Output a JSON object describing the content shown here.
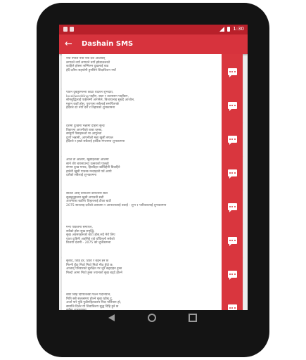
{
  "status_bar": {
    "time": "1:30"
  },
  "app_bar": {
    "back_icon": "←",
    "title": "Dashain SMS"
  },
  "sms_list": [
    {
      "text": "नयाँ नेपाल नयाँ नयाँ दशैं आउन्छर्\nलगाउने नयाँ लगाउने नयाँ झोडाजलको\nकाहिले होस्सा सम्मिलन दुखलाई बाड\nहेर्दै दशैंमा सहयोगी हुनसिने शिदाविजन नयाँ"
    },
    {
      "text": "पावन दुबकुमिल्ला काढा थेर्दैतल शुभदेवा,\nlocal/wedding पाहीए, बाटा र उल्लासन पाहाँछन,\nसोमबुद्धिलाई पाईसम्मी आगमेले, बिजायलाइ सुख्दै आजोल,\nमहान् कहाँ होस्, पुराणमा सबैलाई समर्पितगर्छ\nहेर्दैतल दर नयाँ दशै र तिहारको शुभकामना"
    },
    {
      "text": "दशैंमा दुःखमा भन्नामी दहिनी सुन्दः\nतिहारमा आफ्नीको बाबा रहन्छ,\nसम्मुगाँ पैसाहरूलो मा आपुरुवा\nदुःगाँ भन्नामी, आफ्नीलो मन्ना खुसी सफल\nहेर्दैतले र हाम्रो सबैलाई हार्दिक मंगलमय शुभकामना"
    },
    {
      "text": "आज तो आलागे, खुसीहरुको आलमी\nसाने तोर बारसाउन्दा उत्सवको पालहो\nसंगमा दुःख मनाद, हिबदिहर खाँबिहेनी बिदाहिरे\nहावेनी खुसी पाउन्छ मन्दाइको पर्व आयो\nदशैंको सबैलाई शुभकामना"
    },
    {
      "text": "सीतल ओस् तिनाउनी वसन्तानी सडी\nसुखहुनुहरुमा खुसी लगाउनी सडी\nआफ्नाका बडाँपेर तिहारलाई टीका बाटी\n2075 साल्लाइ दशैंको उत्सवमा र आफन्तालाई बधाई - शुभ १ पारिवारलाई शुभकामना"
    },
    {
      "text": "मन्य पाकतेमा समीपले,\nसबैको होस सुख समृद्धि,\nसुख अवसरहरूको बाटा होस् सदै मेरो लिए\nयाता दुःहिनी अवसिहे राहे घाँदिनुलौ सबैको\nबिजया दशमी - 2075 को शुभकामना"
    },
    {
      "text": "सुरुदि, तिहि हेरे, टिको रे बड्ने द्दने छ\nमिल्नी हुँदा मिठो मिठो मिठो मीठ हुँदो छ,\nआजाद् परिवारको सुरक्षित गर जुरै बढ्दाहन हुन्छ\nमिल्दो आमा मिठो हुन्छ ज्यानको सुख बढ्दै होल्ने"
    },
    {
      "text": "बाँटि बिहि दिपितिलडा फल्न पदनियान,\nमिति सबै सलत्समय होल्ने सुख रहोस् दु,\nअर्जा पारे पुडि पुढीपहितवलय निदा पलियान हो,\nसमाजि दिलेर यो शिवाविलय सुद्ध दिहि हुने छ\nसबैमा शुभकामना"
    }
  ]
}
